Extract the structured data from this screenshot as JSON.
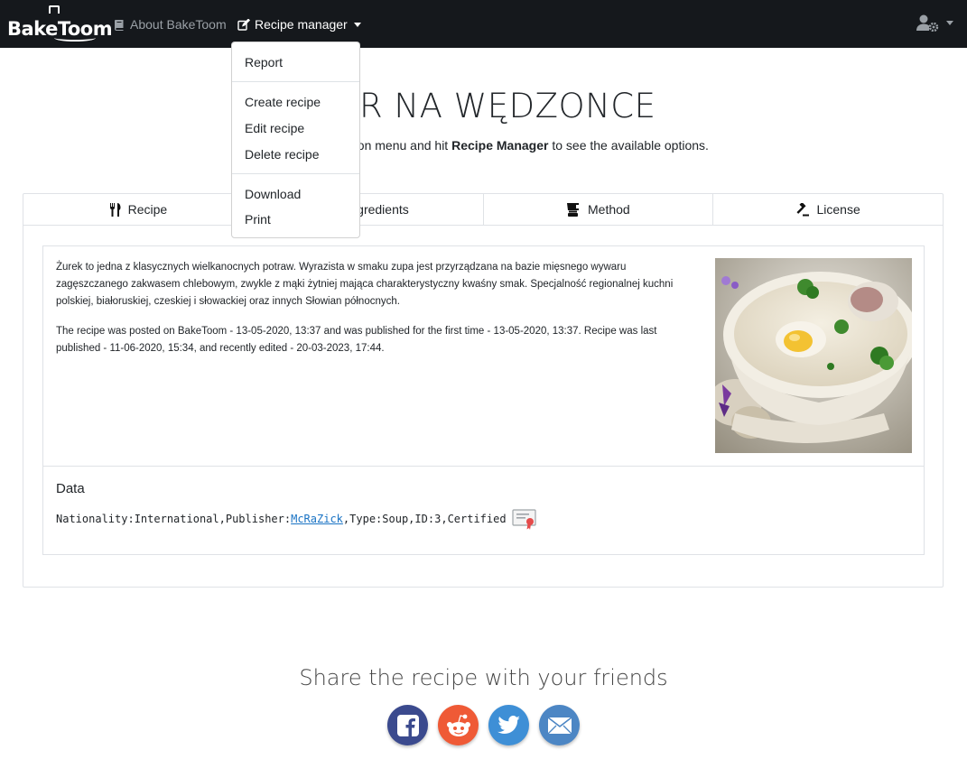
{
  "navbar": {
    "brand": "BakeToom",
    "about_label": "About BakeToom",
    "recipe_manager_label": "Recipe manager",
    "icons": {
      "about": "book-icon",
      "recipe_manager": "edit-icon",
      "user": "user-cog-icon"
    }
  },
  "dropdown": {
    "items": [
      "Report",
      "Create recipe",
      "Edit recipe",
      "Delete recipe",
      "Download",
      "Print"
    ]
  },
  "page": {
    "title": "ŻUR NA WĘDZONCE",
    "lead_prefix": "Open the navigation menu and hit ",
    "lead_bold": "Recipe Manager",
    "lead_suffix": " to see the available options."
  },
  "tabs": [
    {
      "label": "Recipe",
      "icon": "utensils-icon"
    },
    {
      "label": "Ingredients",
      "icon": "list-icon"
    },
    {
      "label": "Method",
      "icon": "blender-icon"
    },
    {
      "label": "License",
      "icon": "gavel-icon"
    }
  ],
  "recipe": {
    "description": "Żurek to jedna z klasycznych wielkanocnych potraw. Wyrazista w smaku zupa jest przyrządzana na bazie mięsnego wywaru zagęszczanego zakwasem chlebowym, zwykle z mąki żytniej mająca charakterystyczny kwaśny smak. Specjalność regionalnej kuchni polskiej, białoruskiej, czeskiej i słowackiej oraz innych Słowian północnych.",
    "posted": "The recipe was posted on BakeToom - 13-05-2020, 13:37 and was published for the first time - 13-05-2020, 13:37. Recipe was last published - 11-06-2020, 15:34, and recently edited - 20-03-2023, 17:44."
  },
  "data": {
    "heading": "Data",
    "nationality_label": "Nationality:",
    "nationality": "International",
    "publisher_label": "Publisher:",
    "publisher": "McRaZick",
    "type_label": "Type:",
    "type": "Soup",
    "id_label": "ID:",
    "id": "3",
    "certified": "Certified",
    "sep": ","
  },
  "share": {
    "heading": "Share the recipe with your friends",
    "buttons": [
      {
        "name": "facebook",
        "color": "#3b4a8e"
      },
      {
        "name": "reddit",
        "color": "#ef5a36"
      },
      {
        "name": "twitter",
        "color": "#3e8fd6"
      },
      {
        "name": "email",
        "color": "#4c86c4"
      }
    ]
  }
}
